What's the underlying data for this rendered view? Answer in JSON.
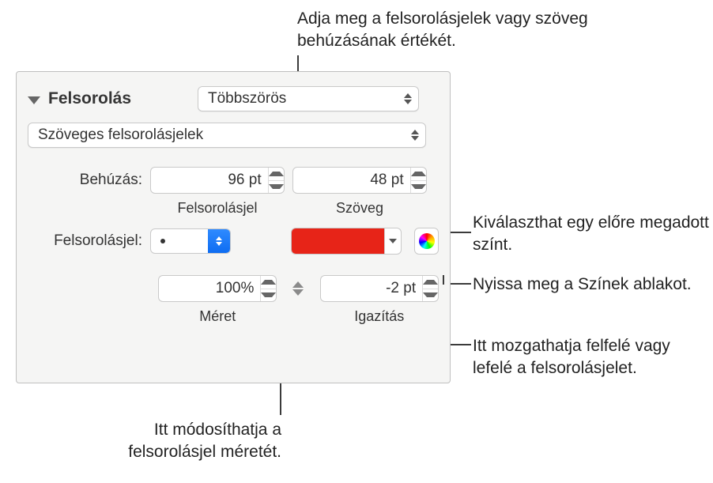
{
  "callouts": {
    "indent": "Adja meg a felsorolásjelek vagy szöveg behúzásának értékét.",
    "preset_color": "Kiválaszthat egy előre megadott színt.",
    "open_colors": "Nyissa meg a Színek ablakot.",
    "move_bullet": "Itt mozgathatja felfelé vagy lefelé a felsorolásjelet.",
    "size": "Itt módosíthatja a felsorolásjel méretét."
  },
  "panel": {
    "section": "Felsorolás",
    "list_type": "Többszörös",
    "bullet_type": "Szöveges felsorolásjelek",
    "indent_label": "Behúzás:",
    "bullet_indent_value": "96 pt",
    "text_indent_value": "48 pt",
    "bullet_sublabel": "Felsorolásjel",
    "text_sublabel": "Szöveg",
    "bullet_label": "Felsorolásjel:",
    "bullet_char": "•",
    "color_hex": "#e72418",
    "size_value": "100%",
    "size_sublabel": "Méret",
    "align_value": "-2 pt",
    "align_sublabel": "Igazítás"
  }
}
